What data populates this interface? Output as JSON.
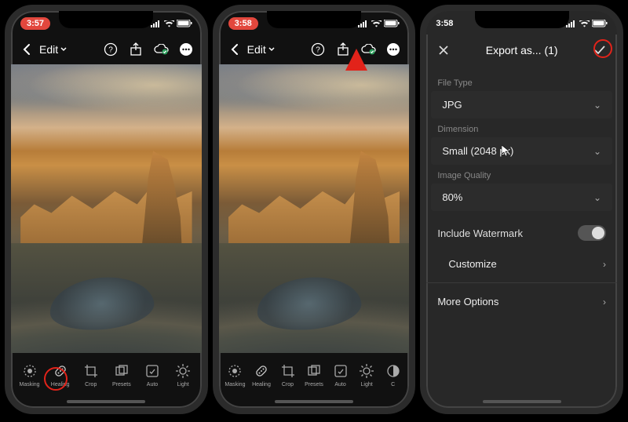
{
  "statusbar": {
    "times": [
      "3:57",
      "3:58",
      "3:58"
    ]
  },
  "nav": {
    "edit_label": "Edit"
  },
  "tools": [
    {
      "key": "masking",
      "label": "Masking"
    },
    {
      "key": "healing",
      "label": "Healing"
    },
    {
      "key": "crop",
      "label": "Crop"
    },
    {
      "key": "presets",
      "label": "Presets"
    },
    {
      "key": "auto",
      "label": "Auto"
    },
    {
      "key": "light",
      "label": "Light"
    },
    {
      "key": "color",
      "label": "C"
    }
  ],
  "export": {
    "title": "Export as... (1)",
    "sections": {
      "file_type": {
        "label": "File Type",
        "value": "JPG"
      },
      "dimension": {
        "label": "Dimension",
        "value": "Small (2048 px)"
      },
      "quality": {
        "label": "Image Quality",
        "value": "80%"
      }
    },
    "watermark": {
      "label": "Include Watermark",
      "customize": "Customize"
    },
    "more": {
      "label": "More Options"
    }
  }
}
